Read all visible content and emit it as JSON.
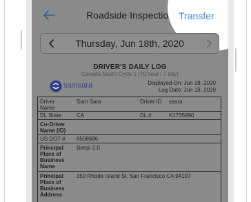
{
  "nav": {
    "title": "Roadside Inspection",
    "transfer_label": "Transfer"
  },
  "date_bar": {
    "date": "Thursday, Jun 18th, 2020"
  },
  "log_header": {
    "title": "DRIVER'S DAILY LOG",
    "cycle": "Canada South Cycle 1 (70 hour / 7 day)",
    "brand": "samsara",
    "displayed_on": "Displayed On: Jun 18, 2020",
    "log_date": "Log Date: Jun 18, 2020"
  },
  "log_table": {
    "driver_name_label": "Driver Name",
    "driver_name_value": "Sam Sara",
    "driver_id_label": "Driver ID",
    "driver_id_value": "ssara",
    "dl_state_label": "DL State",
    "dl_state_value": "CA",
    "dl_number_label": "DL #",
    "dl_number_value": "K1735990",
    "codriver_label": "Co-Driver Name (ID)",
    "codriver_value": "",
    "usdot_label": "US DOT #",
    "usdot_value": "8508686",
    "ppb_name_label": "Principal Place of Business Name",
    "ppb_name_value": "Beepi 2.0",
    "ppb_address_label": "Principal Place of Business Address",
    "ppb_address_value": "350 Rhode Island St, San Francisco CA 94107"
  },
  "colors": {
    "accent": "#3a86d8",
    "brand": "#2f3f88",
    "overlay": "#8a8a8a"
  },
  "icons": {
    "back": "arrow-left-icon",
    "prev": "chevron-left-icon",
    "next": "chevron-right-icon",
    "logo": "samsara-logo-icon"
  }
}
